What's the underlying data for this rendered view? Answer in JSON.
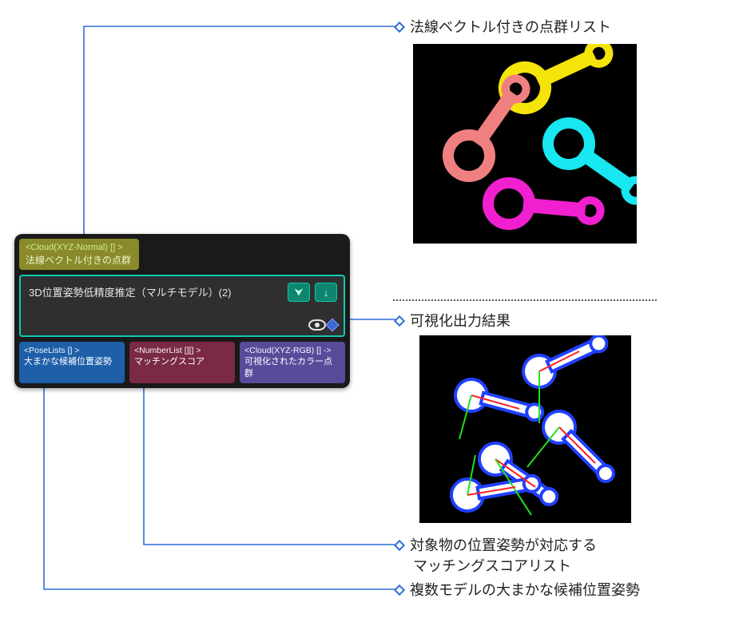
{
  "annotations": {
    "top": "法線ベクトル付きの点群リスト",
    "vis": "可視化出力結果",
    "score1": "対象物の位置姿勢が対応する",
    "score2": "マッチングスコアリスト",
    "pose": "複数モデルの大まかな候補位置姿勢"
  },
  "node": {
    "input": {
      "type": "<Cloud(XYZ-Normal) [] >",
      "label": "法線ベクトル付きの点群"
    },
    "title": "3D位置姿勢低精度推定（マルチモデル）(2)",
    "outputs": [
      {
        "type": "<PoseLists [] >",
        "label": "大まかな候補位置姿勢"
      },
      {
        "type": "<NumberList [][] >",
        "label": "マッチングスコア"
      },
      {
        "type": "<Cloud(XYZ-RGB) [] ->",
        "label": "可視化されたカラー点群"
      }
    ]
  },
  "icons": {
    "expand": "⮟",
    "down": "↓"
  }
}
